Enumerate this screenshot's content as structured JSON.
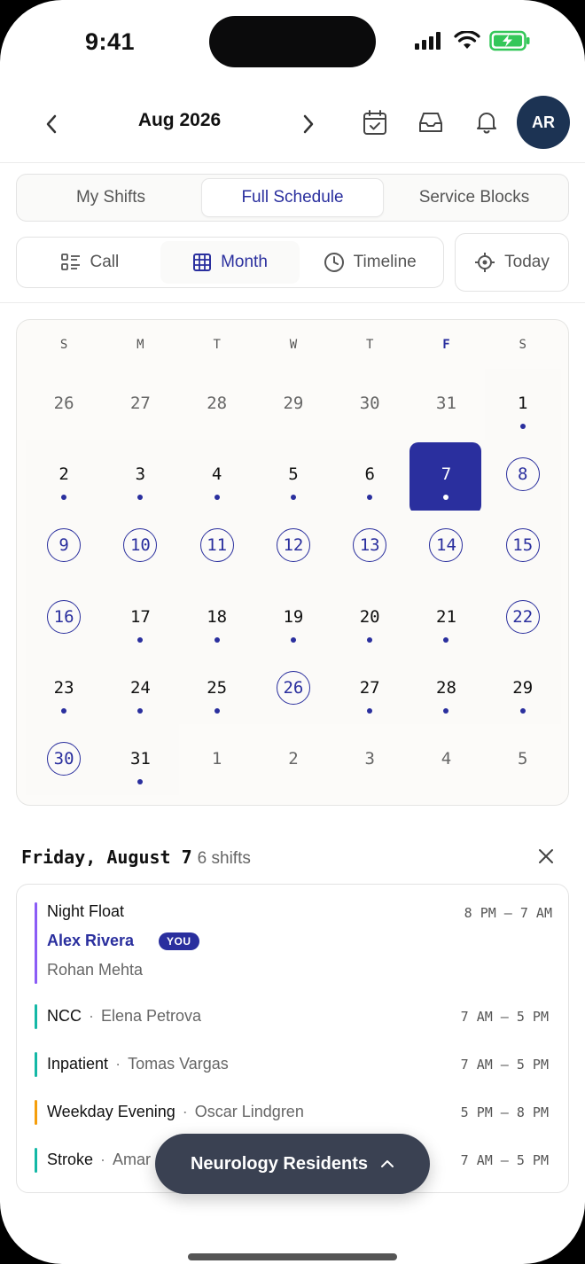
{
  "status_bar": {
    "time": "9:41"
  },
  "header": {
    "month_label": "Aug 2026",
    "avatar_initials": "AR"
  },
  "schedule_tabs": [
    {
      "label": "My Shifts",
      "active": false
    },
    {
      "label": "Full Schedule",
      "active": true
    },
    {
      "label": "Service Blocks",
      "active": false
    }
  ],
  "view_tabs": [
    {
      "label": "Call",
      "icon": "list-icon",
      "active": false
    },
    {
      "label": "Month",
      "icon": "grid-icon",
      "active": true
    },
    {
      "label": "Timeline",
      "icon": "clock-icon",
      "active": false
    }
  ],
  "today_button": {
    "label": "Today",
    "icon": "target-icon"
  },
  "calendar": {
    "weekdays": [
      "S",
      "M",
      "T",
      "W",
      "T",
      "F",
      "S"
    ],
    "highlight_weekday_index": 5,
    "weeks": [
      [
        {
          "d": "26",
          "muted": true
        },
        {
          "d": "27",
          "muted": true
        },
        {
          "d": "28",
          "muted": true
        },
        {
          "d": "29",
          "muted": true
        },
        {
          "d": "30",
          "muted": true
        },
        {
          "d": "31",
          "muted": true
        },
        {
          "d": "1",
          "dot": true
        }
      ],
      [
        {
          "d": "2",
          "dot": true
        },
        {
          "d": "3",
          "dot": true
        },
        {
          "d": "4",
          "dot": true
        },
        {
          "d": "5",
          "dot": true
        },
        {
          "d": "6",
          "dot": true
        },
        {
          "d": "7",
          "dot": true,
          "selected": true
        },
        {
          "d": "8",
          "ring": true
        }
      ],
      [
        {
          "d": "9",
          "ring": true
        },
        {
          "d": "10",
          "ring": true
        },
        {
          "d": "11",
          "ring": true
        },
        {
          "d": "12",
          "ring": true
        },
        {
          "d": "13",
          "ring": true
        },
        {
          "d": "14",
          "ring": true
        },
        {
          "d": "15",
          "ring": true
        }
      ],
      [
        {
          "d": "16",
          "ring": true
        },
        {
          "d": "17",
          "dot": true
        },
        {
          "d": "18",
          "dot": true
        },
        {
          "d": "19",
          "dot": true
        },
        {
          "d": "20",
          "dot": true
        },
        {
          "d": "21",
          "dot": true
        },
        {
          "d": "22",
          "ring": true
        }
      ],
      [
        {
          "d": "23",
          "dot": true
        },
        {
          "d": "24",
          "dot": true
        },
        {
          "d": "25",
          "dot": true
        },
        {
          "d": "26",
          "ring": true
        },
        {
          "d": "27",
          "dot": true
        },
        {
          "d": "28",
          "dot": true
        },
        {
          "d": "29",
          "dot": true
        }
      ],
      [
        {
          "d": "30",
          "ring": true
        },
        {
          "d": "31",
          "dot": true
        },
        {
          "d": "1",
          "muted": true
        },
        {
          "d": "2",
          "muted": true
        },
        {
          "d": "3",
          "muted": true
        },
        {
          "d": "4",
          "muted": true
        },
        {
          "d": "5",
          "muted": true
        }
      ]
    ]
  },
  "day_detail": {
    "title": "Friday, August 7",
    "count": "6 shifts",
    "primary_shift": {
      "name": "Night Float",
      "time": "8 PM — 7 AM",
      "me": "Alex Rivera",
      "badge": "YOU",
      "other": "Rohan Mehta",
      "color": "#8b5cf6"
    },
    "shifts": [
      {
        "name": "NCC",
        "person": "Elena Petrova",
        "time": "7 AM — 5 PM",
        "color": "#14b8a6"
      },
      {
        "name": "Inpatient",
        "person": "Tomas Vargas",
        "time": "7 AM — 5 PM",
        "color": "#14b8a6"
      },
      {
        "name": "Weekday Evening",
        "person": "Oscar Lindgren",
        "time": "5 PM — 8 PM",
        "color": "#f59e0b"
      },
      {
        "name": "Stroke",
        "person": "Amar",
        "time": "7 AM — 5 PM",
        "color": "#14b8a6"
      }
    ]
  },
  "group_selector": {
    "label": "Neurology Residents"
  },
  "colors": {
    "accent": "#2a2f9e",
    "avatar_bg": "#1c3353",
    "pill_bg": "#3a4152"
  }
}
